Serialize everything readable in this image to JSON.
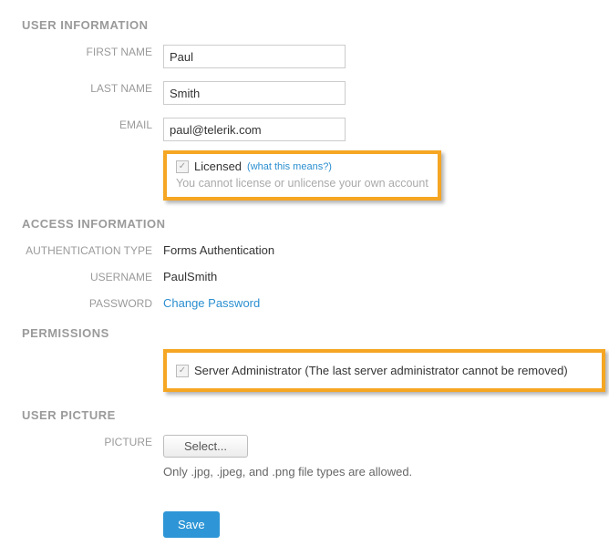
{
  "sections": {
    "user_info": "USER INFORMATION",
    "access_info": "ACCESS INFORMATION",
    "permissions": "PERMISSIONS",
    "user_picture": "USER PICTURE"
  },
  "user": {
    "first_name_label": "FIRST NAME",
    "first_name_value": "Paul",
    "last_name_label": "LAST NAME",
    "last_name_value": "Smith",
    "email_label": "EMAIL",
    "email_value": "paul@telerik.com"
  },
  "licensed": {
    "label": "Licensed",
    "help_link": "(what this means?)",
    "note": "You cannot license or unlicense your own account"
  },
  "access": {
    "auth_type_label": "AUTHENTICATION TYPE",
    "auth_type_value": "Forms Authentication",
    "username_label": "USERNAME",
    "username_value": "PaulSmith",
    "password_label": "PASSWORD",
    "password_link": "Change Password"
  },
  "permissions_box": {
    "label": "Server Administrator (The last server administrator cannot be removed)"
  },
  "picture": {
    "label": "PICTURE",
    "button": "Select...",
    "hint": "Only .jpg, .jpeg, and .png file types are allowed."
  },
  "actions": {
    "save": "Save"
  }
}
